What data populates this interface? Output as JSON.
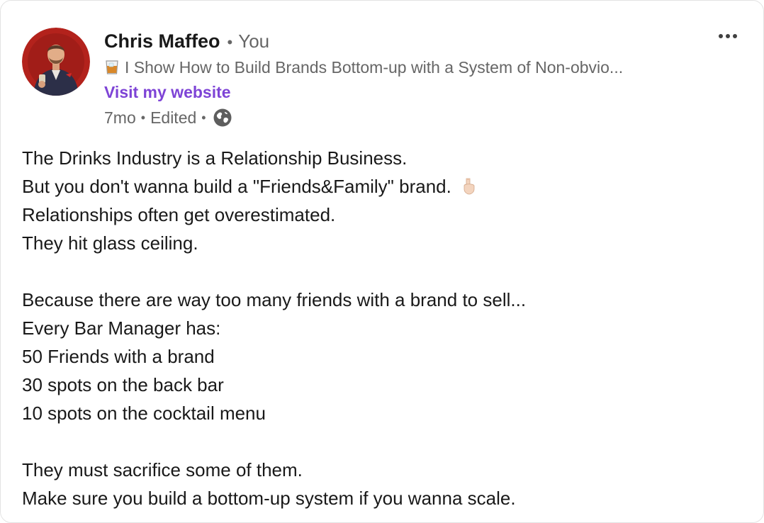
{
  "post": {
    "author": {
      "name": "Chris Maffeo",
      "separator": "•",
      "relation": "You",
      "headline": "I Show How to Build Brands Bottom-up with a System of Non-obvio...",
      "headline_icon": "whisky-glass-icon",
      "website_link": "Visit my website"
    },
    "timestamp": "7mo",
    "edited_label": "Edited",
    "visibility_icon": "globe-icon",
    "more_menu_icon": "ellipsis-icon",
    "lines": [
      "The Drinks Industry is a Relationship Business.",
      "But you don't wanna build a \"Friends&Family\" brand.",
      "Relationships often get overestimated.",
      "They hit glass ceiling.",
      "",
      "Because there are way too many friends with a brand to sell...",
      "Every Bar Manager has:",
      "50 Friends with a brand",
      "30 spots on the back bar",
      "10 spots on the cocktail menu",
      "",
      "They must sacrifice some of them.",
      "Make sure you build a bottom-up system if you wanna scale."
    ],
    "inline_emoji": "pointing-down-hand-icon"
  },
  "colors": {
    "link_purple": "#7e44d6",
    "secondary_text": "#666666",
    "primary_text": "#191919",
    "avatar_background": "#b3221c"
  }
}
